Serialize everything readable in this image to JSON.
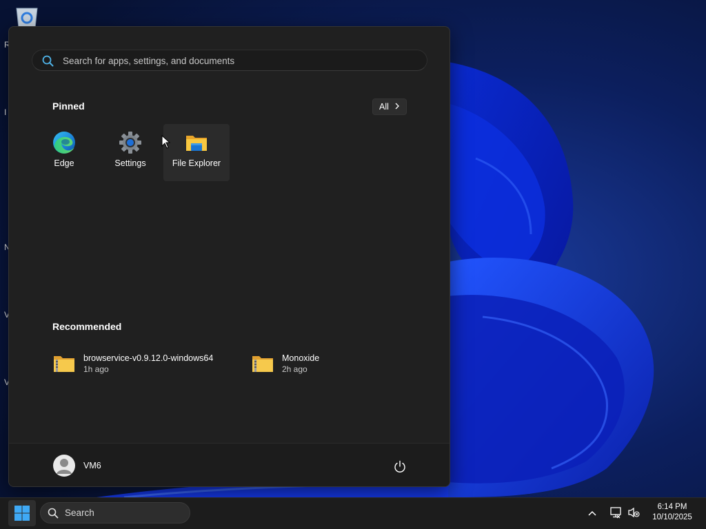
{
  "desktop": {
    "wallpaper": "windows-11-bloom-blue",
    "icons": [
      {
        "icon": "recycle-bin-icon"
      }
    ],
    "edge_letters": [
      "R",
      "I",
      "N",
      "V",
      "V"
    ]
  },
  "start_menu": {
    "search": {
      "placeholder": "Search for apps, settings, and documents"
    },
    "pinned": {
      "title": "Pinned",
      "all_button": "All",
      "apps": [
        {
          "label": "Edge",
          "icon": "edge-icon"
        },
        {
          "label": "Settings",
          "icon": "settings-gear-icon"
        },
        {
          "label": "File Explorer",
          "icon": "file-explorer-folder-icon"
        }
      ]
    },
    "recommended": {
      "title": "Recommended",
      "items": [
        {
          "name": "browservice-v0.9.12.0-windows64",
          "time": "1h ago",
          "icon": "zip-folder-icon"
        },
        {
          "name": "Monoxide",
          "time": "2h ago",
          "icon": "zip-folder-icon"
        }
      ]
    },
    "user": {
      "name": "VM6"
    }
  },
  "taskbar": {
    "search_label": "Search",
    "clock": {
      "time": "6:14 PM",
      "date": "10/10/2025"
    }
  },
  "colors": {
    "menu_bg": "#202020",
    "taskbar_bg": "#1c1c1c",
    "accent_blue": "#0078d4"
  }
}
